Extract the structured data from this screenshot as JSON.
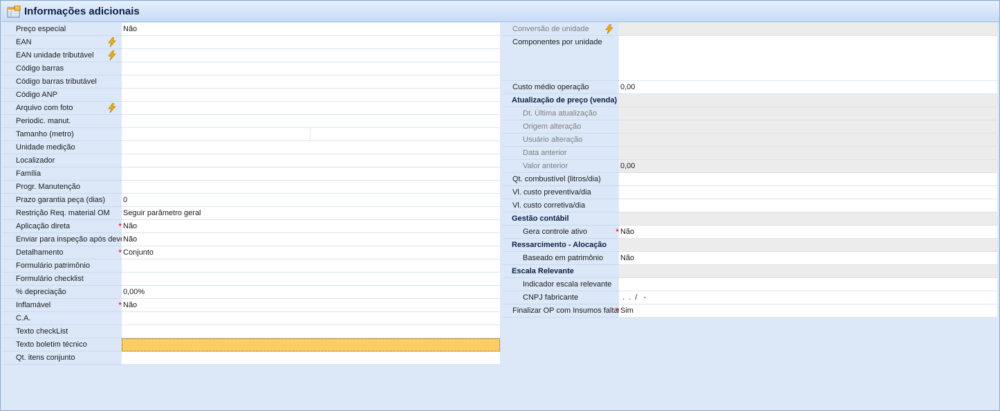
{
  "header": {
    "title": "Informações adicionais",
    "icon": "table-icon"
  },
  "left": [
    {
      "label": "Preço especial",
      "value": "Não"
    },
    {
      "label": "EAN",
      "value": "",
      "bolt": true
    },
    {
      "label": "EAN unidade tributável",
      "value": "",
      "bolt": true
    },
    {
      "label": "Código barras",
      "value": ""
    },
    {
      "label": "Código barras tributável",
      "value": ""
    },
    {
      "label": "Código ANP",
      "value": ""
    },
    {
      "label": "Arquivo com foto",
      "value": "",
      "bolt": true
    },
    {
      "label": "Periodic. manut.",
      "value": ""
    },
    {
      "label": "Tamanho (metro)",
      "value": "",
      "split": true
    },
    {
      "label": "Unidade medição",
      "value": ""
    },
    {
      "label": "Localizador",
      "value": ""
    },
    {
      "label": "Família",
      "value": ""
    },
    {
      "label": "Progr. Manutenção",
      "value": ""
    },
    {
      "label": "Prazo garantia peça (dias)",
      "value": "0"
    },
    {
      "label": "Restrição Req. material OM",
      "value": "Seguir parâmetro geral"
    },
    {
      "label": "Aplicação direta",
      "value": "Não",
      "required": true
    },
    {
      "label": "Enviar para inspeção após devolução",
      "value": "Não"
    },
    {
      "label": "Detalhamento",
      "value": "Conjunto",
      "required": true
    },
    {
      "label": "Formulário patrimônio",
      "value": ""
    },
    {
      "label": "Formulário checklist",
      "value": ""
    },
    {
      "label": "% depreciação",
      "value": "0,00%"
    },
    {
      "label": "Inflamável",
      "value": "Não",
      "required": true
    },
    {
      "label": "C.A.",
      "value": ""
    },
    {
      "label": "Texto checkList",
      "value": ""
    },
    {
      "label": "Texto boletim técnico",
      "value": "",
      "selected": true
    },
    {
      "label": "Qt. itens conjunto",
      "value": ""
    }
  ],
  "right": {
    "conversao_label": "Conversão de unidade",
    "componentes_label": "Componentes por unidade",
    "custo_medio_label": "Custo médio operação",
    "custo_medio_value": "0,00",
    "atualizacao_title": "Atualização de preço (venda)",
    "dt_ultima_label": "Dt. Última atualização",
    "origem_label": "Origem alteração",
    "usuario_label": "Usuário alteração",
    "data_anterior_label": "Data anterior",
    "valor_anterior_label": "Valor anterior",
    "valor_anterior_value": "0,00",
    "qt_combustivel_label": "Qt. combustível (litros/dia)",
    "vl_preventiva_label": "Vl. custo preventiva/dia",
    "vl_corretiva_label": "Vl. custo corretiva/dia",
    "gestao_title": "Gestão contábil",
    "gera_controle_label": "Gera controle ativo",
    "gera_controle_value": "Não",
    "ressarcimento_title": "Ressarcimento - Alocação",
    "baseado_label": "Baseado em patrimônio",
    "baseado_value": "Não",
    "escala_title": "Escala Relevante",
    "indicador_label": "Indicador escala relevante",
    "cnpj_label": "CNPJ fabricante",
    "cnpj_value": " .  .  /   -",
    "finalizar_label": "Finalizar OP com Insumos faltantes",
    "finalizar_value": "Sim"
  },
  "colors": {
    "panel": "#dce8f8",
    "selected": "#ffcd66",
    "required": "#d20000",
    "bolt": "#f0b400"
  }
}
